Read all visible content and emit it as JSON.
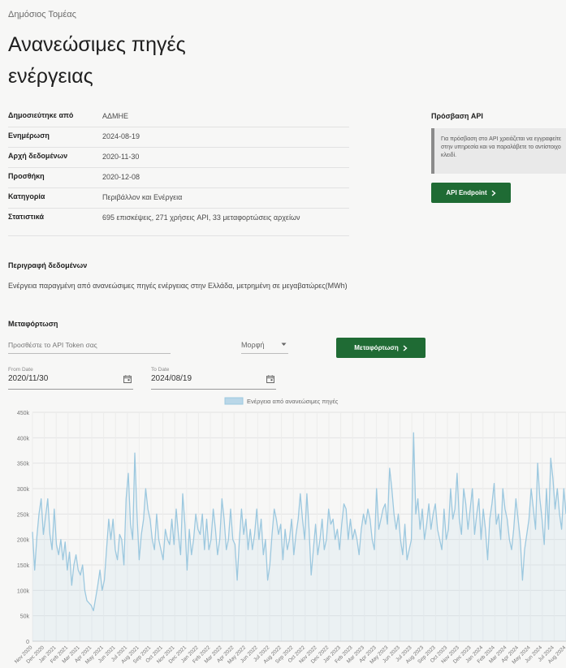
{
  "breadcrumb": "Δημόσιος Τομέας",
  "title": "Ανανεώσιμες πηγές ενέργειας",
  "metadata": [
    {
      "key": "Δημοσιεύτηκε από",
      "value": "ΑΔΜΗΕ"
    },
    {
      "key": "Ενημέρωση",
      "value": "2024-08-19"
    },
    {
      "key": "Αρχή δεδομένων",
      "value": "2020-11-30"
    },
    {
      "key": "Προσθήκη",
      "value": "2020-12-08"
    },
    {
      "key": "Κατηγορία",
      "value": "Περιβάλλον και Ενέργεια"
    },
    {
      "key": "Στατιστικά",
      "value": "695 επισκέψεις, 271 χρήσεις API, 33 μεταφορτώσεις αρχείων"
    }
  ],
  "api": {
    "title": "Πρόσβαση API",
    "note": "Για πρόσβαση στο API χρειάζεται να εγγραφείτε στην υπηρεσία και να παραλάβετε το αντίστοιχο κλειδί.",
    "button_label": "API Endpoint"
  },
  "description": {
    "title": "Περιγραφή δεδομένων",
    "text": "Ενέργεια παραγμένη από ανανεώσιμες πηγές ενέργειας στην Ελλάδα, μετρημένη σε μεγαβατώρες(MWh)"
  },
  "download": {
    "title": "Μεταφόρτωση",
    "token_placeholder": "Προσθέστε το API Token σας",
    "format_label": "Μορφή",
    "button_label": "Μεταφόρτωση",
    "from_label": "From Date",
    "from_value": "2020/11/30",
    "to_label": "To Date",
    "to_value": "2024/08/19"
  },
  "icons": {
    "arrow": "chevron-right-icon",
    "calendar": "calendar-icon",
    "dropdown": "caret-down-icon"
  },
  "colors": {
    "accent": "#1f6b34",
    "series": "#9cc8df",
    "series_fill": "#b9d7e8"
  },
  "chart_data": {
    "type": "line",
    "legend": "Ενέργεια από ανανεώσιμες πηγές",
    "legend_position": "top-center",
    "grid": true,
    "ylim": [
      0,
      450000
    ],
    "y_ticks": [
      "0",
      "50k",
      "100k",
      "150k",
      "200k",
      "250k",
      "300k",
      "350k",
      "400k",
      "450k"
    ],
    "x_ticks": [
      "Nov 2020",
      "Dec 2020",
      "Jan 2021",
      "Feb 2021",
      "Mar 2021",
      "Apr 2021",
      "May 2021",
      "Jun 2021",
      "Jul 2021",
      "Aug 2021",
      "Sep 2021",
      "Oct 2021",
      "Nov 2021",
      "Dec 2021",
      "Jan 2022",
      "Feb 2022",
      "Mar 2022",
      "Apr 2022",
      "May 2022",
      "Jun 2022",
      "Jul 2022",
      "Aug 2022",
      "Sep 2022",
      "Oct 2022",
      "Nov 2022",
      "Dec 2022",
      "Jan 2023",
      "Feb 2023",
      "Mar 2023",
      "Apr 2023",
      "May 2023",
      "Jun 2023",
      "Jul 2023",
      "Aug 2023",
      "Sep 2023",
      "Oct 2023",
      "Nov 2023",
      "Dec 2023",
      "Jan 2024",
      "Feb 2024",
      "Mar 2024",
      "Apr 2024",
      "May 2024",
      "Jun 2024",
      "Jul 2024",
      "Aug 2024"
    ],
    "series": [
      {
        "values": [
          215000,
          140000,
          205000,
          250000,
          280000,
          210000,
          245000,
          280000,
          210000,
          180000,
          260000,
          190000,
          170000,
          200000,
          160000,
          195000,
          140000,
          175000,
          110000,
          150000,
          170000,
          140000,
          130000,
          150000,
          100000,
          80000,
          75000,
          70000,
          60000,
          85000,
          110000,
          140000,
          100000,
          120000,
          180000,
          240000,
          200000,
          240000,
          180000,
          160000,
          210000,
          200000,
          150000,
          280000,
          330000,
          230000,
          200000,
          370000,
          250000,
          160000,
          210000,
          240000,
          300000,
          260000,
          240000,
          200000,
          180000,
          250000,
          200000,
          180000,
          160000,
          220000,
          200000,
          190000,
          240000,
          190000,
          260000,
          210000,
          170000,
          290000,
          230000,
          140000,
          220000,
          170000,
          200000,
          250000,
          220000,
          210000,
          250000,
          180000,
          240000,
          180000,
          200000,
          260000,
          220000,
          170000,
          200000,
          280000,
          240000,
          180000,
          200000,
          260000,
          200000,
          190000,
          120000,
          200000,
          260000,
          210000,
          240000,
          180000,
          220000,
          180000,
          210000,
          260000,
          200000,
          240000,
          170000,
          200000,
          120000,
          150000,
          210000,
          260000,
          240000,
          210000,
          230000,
          160000,
          220000,
          180000,
          200000,
          240000,
          170000,
          210000,
          240000,
          290000,
          240000,
          200000,
          290000,
          220000,
          130000,
          180000,
          230000,
          170000,
          200000,
          240000,
          180000,
          200000,
          260000,
          230000,
          240000,
          200000,
          220000,
          180000,
          230000,
          270000,
          260000,
          200000,
          240000,
          200000,
          220000,
          200000,
          170000,
          220000,
          250000,
          230000,
          260000,
          240000,
          200000,
          180000,
          300000,
          220000,
          240000,
          260000,
          270000,
          230000,
          340000,
          300000,
          250000,
          220000,
          250000,
          200000,
          170000,
          230000,
          160000,
          180000,
          200000,
          410000,
          250000,
          280000,
          220000,
          260000,
          200000,
          230000,
          270000,
          220000,
          250000,
          270000,
          220000,
          200000,
          180000,
          260000,
          200000,
          220000,
          300000,
          240000,
          260000,
          330000,
          240000,
          210000,
          300000,
          270000,
          220000,
          260000,
          300000,
          210000,
          250000,
          280000,
          200000,
          260000,
          220000,
          160000,
          240000,
          270000,
          310000,
          230000,
          250000,
          200000,
          300000,
          260000,
          240000,
          200000,
          180000,
          220000,
          280000,
          240000,
          200000,
          120000,
          180000,
          210000,
          240000,
          300000,
          260000,
          220000,
          350000,
          280000,
          240000,
          190000,
          300000,
          220000,
          360000,
          320000,
          260000,
          300000,
          250000,
          220000,
          300000,
          250000
        ]
      }
    ]
  }
}
